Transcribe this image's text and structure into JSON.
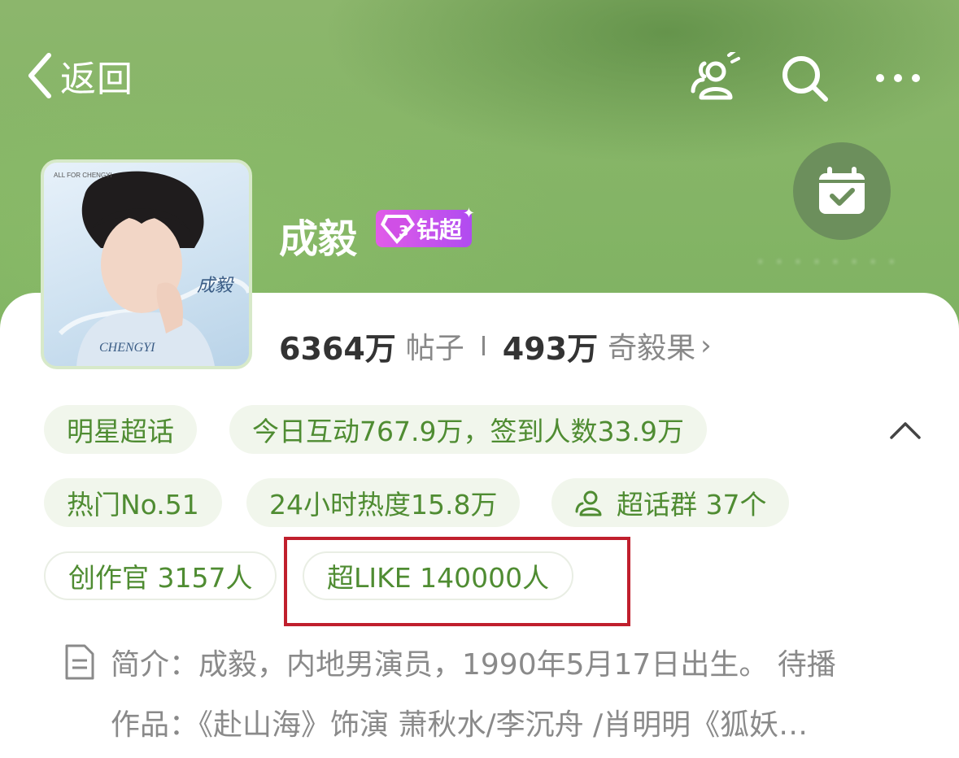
{
  "nav": {
    "back_label": "返回",
    "icons": [
      "group-chat-icon",
      "search-icon",
      "more-icon"
    ]
  },
  "profile": {
    "name": "成毅",
    "badge_label": "钻超",
    "badge_level": "3",
    "avatar_text": {
      "name": "成毅",
      "signature": "CHENGYI",
      "caption": "ALL FOR CHENGYI"
    }
  },
  "checkin": {
    "icon": "calendar-check-icon"
  },
  "stats": {
    "posts_count": "6364万",
    "posts_label": "帖子",
    "fruits_count": "493万",
    "fruits_label": "奇毅果",
    "chevron": "›"
  },
  "tags": {
    "category": "明星超话",
    "activity": "今日互动767.9万，签到人数33.9万",
    "rank": "热门No.51",
    "heat": "24小时热度15.8万",
    "groups": "超话群 37个",
    "creators": "创作官 3157人",
    "super_like": "超LIKE 140000人"
  },
  "intro": {
    "line1": "简介：成毅，内地男演员，1990年5月17日出生。 待播",
    "line2": "作品：《赴山海》饰演 萧秋水/李沉舟 /肖明明《狐妖…"
  },
  "colors": {
    "header_green": "#86b567",
    "chip_bg": "#f1f6ec",
    "chip_text": "#4f8c32",
    "badge_purple": "#c552ec",
    "highlight_red": "#c01f2d"
  }
}
